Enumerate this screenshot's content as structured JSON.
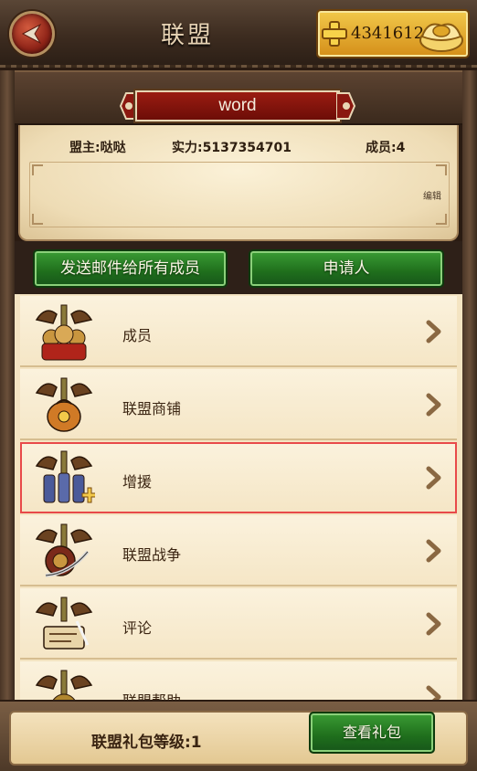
{
  "header": {
    "title": "联盟",
    "gold_amount": "4341612"
  },
  "alliance": {
    "name": "word",
    "leader_text": "盟主:哒哒",
    "power_text": "实力:5137354701",
    "members_text": "成员:4",
    "edit_label": "编辑",
    "notice": ""
  },
  "actions": {
    "mail_all_label": "发送邮件给所有成员",
    "applicants_label": "申请人"
  },
  "menu": {
    "items": [
      {
        "label": "成员",
        "icon": "members-crest-icon"
      },
      {
        "label": "联盟商铺",
        "icon": "shop-crest-icon"
      },
      {
        "label": "增援",
        "icon": "reinforce-crest-icon",
        "selected": true
      },
      {
        "label": "联盟战争",
        "icon": "war-crest-icon"
      },
      {
        "label": "评论",
        "icon": "comment-crest-icon"
      },
      {
        "label": "联盟帮助",
        "icon": "help-crest-icon"
      }
    ]
  },
  "footer": {
    "gift_level_text": "联盟礼包等级:1",
    "view_gift_label": "查看礼包"
  },
  "colors": {
    "accent_green": "#2a8a26",
    "banner_red": "#8a1810",
    "highlight_outline": "#e84a4a"
  }
}
